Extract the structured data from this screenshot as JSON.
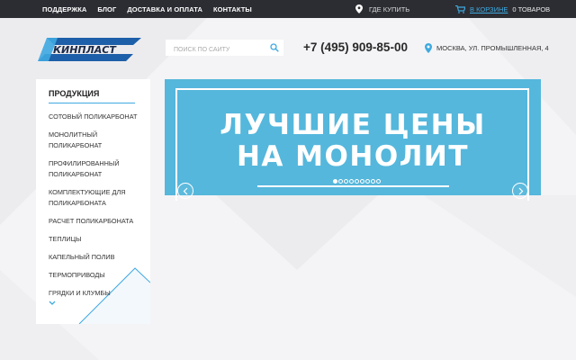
{
  "topbar": {
    "nav": [
      "ПОДДЕРЖКА",
      "БЛОГ",
      "ДОСТАВКА И ОПЛАТА",
      "КОНТАКТЫ"
    ],
    "where_buy": "ГДЕ КУПИТЬ",
    "cart_link": "В КОРЗИНЕ",
    "cart_count": "0 ТОВАРОВ"
  },
  "header": {
    "logo_text": "КИНПЛАСТ",
    "search_placeholder": "ПОИСК ПО САЙТУ",
    "phone": "+7 (495) 909-85-00",
    "address": "МОСКВА, УЛ. ПРОМЫШЛЕННАЯ, 4"
  },
  "sidebar": {
    "heading": "ПРОДУКЦИЯ",
    "items": [
      "СОТОВЫЙ ПОЛИКАРБОНАТ",
      "МОНОЛИТНЫЙ ПОЛИКАРБОНАТ",
      "ПРОФИЛИРОВАННЫЙ ПОЛИКАРБОНАТ",
      "КОМПЛЕКТУЮЩИЕ ДЛЯ ПОЛИКАРБОНАТА",
      "РАСЧЕТ ПОЛИКАРБОНАТА",
      "ТЕПЛИЦЫ",
      "КАПЕЛЬНЫЙ ПОЛИВ",
      "ТЕРМОПРИВОДЫ",
      "ГРЯДКИ И КЛУМБЫ"
    ]
  },
  "banner": {
    "line1": "ЛУЧШИЕ ЦЕНЫ",
    "line2": "НА МОНОЛИТ",
    "slide_count": 9,
    "active_slide": 1
  },
  "colors": {
    "topbar_bg": "#2c2d33",
    "accent": "#3fa9e0",
    "banner_bg": "#55b7dc",
    "logo_blue": "#1d5fa8"
  },
  "icons": {
    "where_buy": "map-pin-icon",
    "cart": "cart-icon",
    "search": "search-icon",
    "address": "map-marker-icon",
    "prev": "chevron-left-icon",
    "next": "chevron-right-icon",
    "more": "chevron-down-icon"
  }
}
